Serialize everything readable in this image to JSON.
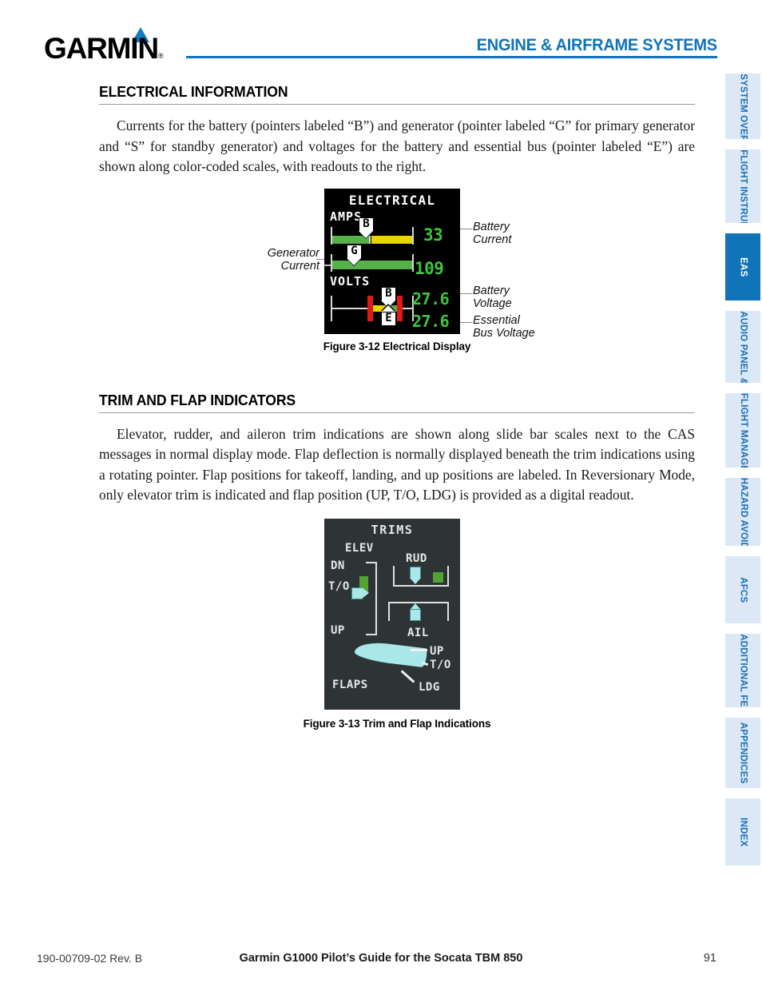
{
  "header": {
    "brand": "GARMIN",
    "brand_mark": "®",
    "title": "ENGINE & AIRFRAME SYSTEMS",
    "accent_color": "#0f74b8"
  },
  "sidebar": {
    "tabs": [
      {
        "label": "SYSTEM OVERVIEW",
        "active": false
      },
      {
        "label": "FLIGHT INSTRUMENTS",
        "active": false
      },
      {
        "label": "EAS",
        "active": true
      },
      {
        "label": "AUDIO PANEL & CNS",
        "active": false
      },
      {
        "label": "FLIGHT MANAGEMENT",
        "active": false
      },
      {
        "label": "HAZARD AVOIDANCE",
        "active": false
      },
      {
        "label": "AFCS",
        "active": false
      },
      {
        "label": "ADDITIONAL FEATURES",
        "active": false
      },
      {
        "label": "APPENDICES",
        "active": false
      },
      {
        "label": "INDEX",
        "active": false
      }
    ]
  },
  "sections": [
    {
      "heading": "ELECTRICAL INFORMATION",
      "paragraph": "Currents for the battery (pointers labeled “B”) and generator (pointer labeled “G” for primary generator and “S” for standby generator) and voltages for the battery and essential bus (pointer labeled “E”) are shown along color-coded scales, with readouts to the right."
    },
    {
      "heading": "TRIM AND FLAP INDICATORS",
      "paragraph": "Elevator, rudder, and aileron trim indications are shown along slide bar scales next to the CAS messages in normal display mode.  Flap deflection is normally displayed beneath the trim indications using a rotating pointer.  Flap positions for takeoff, landing, and up positions are labeled.  In Reversionary Mode, only elevator trim is indicated and flap position (UP, T/O, LDG) is provided as a digital readout."
    }
  ],
  "electrical_figure": {
    "caption": "Figure 3-12  Electrical Display",
    "display_title": "ELECTRICAL",
    "amps_label": "AMPS",
    "volts_label": "VOLTS",
    "pointers": {
      "battery_amps": "B",
      "generator_amps": "G",
      "battery_volts": "B",
      "essential_volts": "E"
    },
    "readouts": {
      "battery_current": "33",
      "generator_current": "109",
      "battery_voltage": "27.6",
      "essential_bus_voltage": "27.6"
    },
    "callouts": {
      "battery_current": "Battery\nCurrent",
      "generator_current": "Generator\nCurrent",
      "battery_voltage": "Battery\nVoltage",
      "essential_bus_voltage": "Essential\nBus Voltage"
    },
    "colors": {
      "green": "#57b14b",
      "yellow": "#e8d500",
      "red": "#e01b15",
      "readout_green": "#3ec43e",
      "background": "#000000"
    }
  },
  "trim_figure": {
    "caption": "Figure 3-13  Trim and Flap Indications",
    "display_title": "TRIMS",
    "labels": {
      "elevator": "ELEV",
      "elevator_dn": "DN",
      "elevator_to": "T/O",
      "elevator_up": "UP",
      "rudder": "RUD",
      "aileron": "AIL",
      "flaps": "FLAPS",
      "flap_up": "UP",
      "flap_to": "T/O",
      "flap_ldg": "LDG"
    },
    "colors": {
      "background": "#2e3436",
      "pointer": "#a9e7e8",
      "range_marker": "#53a234"
    }
  },
  "footer": {
    "doc_number": "190-00709-02  Rev. B",
    "title": "Garmin G1000 Pilot’s Guide for the Socata TBM 850",
    "page_number": "91"
  }
}
